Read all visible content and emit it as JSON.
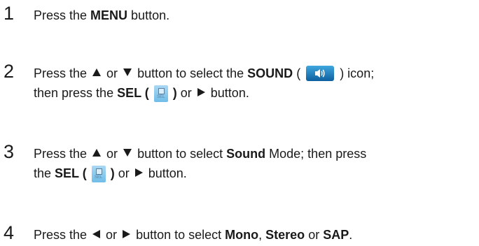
{
  "steps": [
    {
      "number": "1",
      "parts": [
        "Press the ",
        "MENU",
        " button."
      ]
    },
    {
      "number": "2",
      "line1": [
        "Press the ",
        " or ",
        " button to select the ",
        "SOUND",
        " ( ",
        " ) icon;"
      ],
      "line2": [
        "then press the ",
        "SEL (",
        ")",
        " or ",
        " button."
      ]
    },
    {
      "number": "3",
      "line1": [
        "Press the ",
        " or ",
        " button to select ",
        "Sound",
        " Mode; then press"
      ],
      "line2": [
        "the ",
        "SEL (",
        ")",
        " or ",
        " button."
      ]
    },
    {
      "number": "4",
      "parts": [
        "Press the ",
        " or ",
        " button to select ",
        "Mono",
        ", ",
        "Stereo",
        " or ",
        "SAP",
        "."
      ]
    }
  ],
  "icons": {
    "sel_label": "SEL",
    "sound_icon": "speaker-icon",
    "sel_icon": "sel-button-icon"
  },
  "colors": {
    "sound_icon_top": "#3fa7de",
    "sound_icon_bottom": "#0d5f9e",
    "sel_icon": "#8ccbee"
  }
}
